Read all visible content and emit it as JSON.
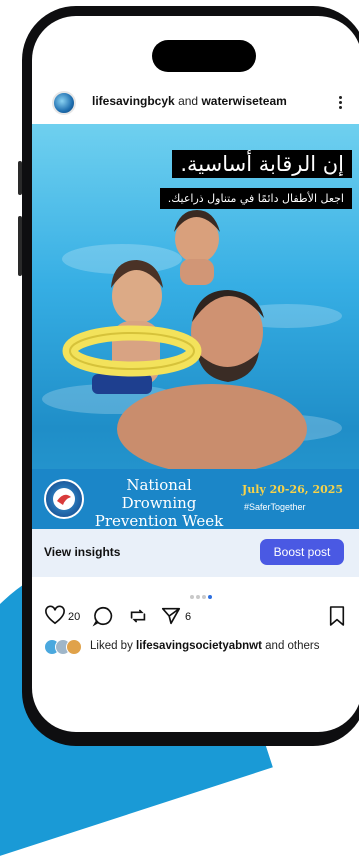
{
  "post": {
    "user_primary": "lifesavingbcyk",
    "user_joiner": "and",
    "user_secondary": "waterwiseteam",
    "image_overlay": {
      "line1": "إن الرقابة أساسية.",
      "line2": "اجعل الأطفال دائمًا في متناول ذراعيك."
    },
    "banner": {
      "title_line1": "National Drowning",
      "title_line2": "Prevention Week",
      "dates": "July 20-26, 2025",
      "hashtag": "#SaferTogether"
    }
  },
  "insights": {
    "view_label": "View insights",
    "boost_label": "Boost post"
  },
  "carousel": {
    "count": 4,
    "active_index": 3
  },
  "actions": {
    "likes_count": "20",
    "shares_count": "6"
  },
  "liked_by": {
    "prefix": "Liked by",
    "user": "lifesavingsocietyabnwt",
    "suffix": "and others"
  },
  "icons": [
    "heart-icon",
    "comment-icon",
    "repost-icon",
    "share-icon",
    "bookmark-icon",
    "more-icon"
  ],
  "colors": {
    "boost_button": "#4a59e3",
    "insights_bg": "#e9f0f9",
    "banner_bg": "#1b86c8",
    "banner_date": "#f6d24a",
    "backdrop_accent": "#1a9ad6"
  }
}
